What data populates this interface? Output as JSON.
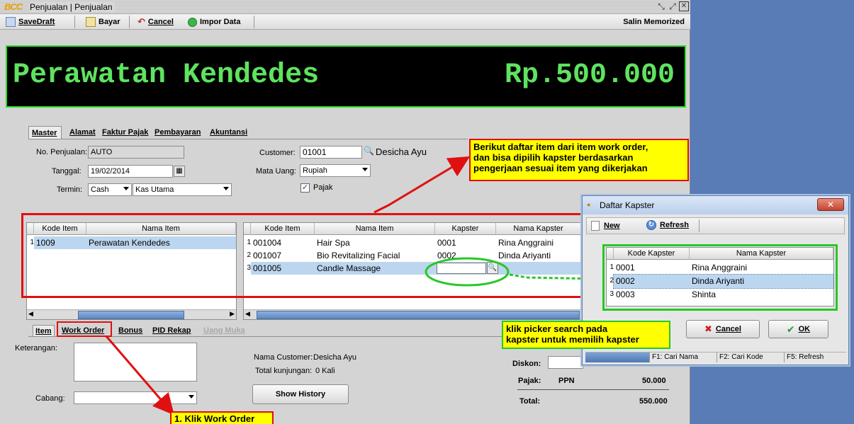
{
  "window": {
    "logo": "BCC",
    "title": "Penjualan | Penjualan",
    "controls": [
      "restore",
      "maximize",
      "close"
    ]
  },
  "toolbar": {
    "save_draft": "SaveDraft",
    "bayar": "Bayar",
    "cancel": "Cancel",
    "impor_data": "Impor Data",
    "salin_memorized": "Salin Memorized"
  },
  "banner": {
    "title": "Perawatan Kendedes",
    "amount": "Rp.500.000",
    "text_color": "#5fe35f",
    "border_color": "#2ddc2d"
  },
  "tabs": {
    "master": "Master",
    "alamat": "Alamat",
    "faktur_pajak": "Faktur Pajak",
    "pembayaran": "Pembayaran",
    "akuntansi": "Akuntansi"
  },
  "form": {
    "no_penjualan_label": "No. Penjualan:",
    "no_penjualan_value": "AUTO",
    "tanggal_label": "Tanggal:",
    "tanggal_value": "19/02/2014",
    "termin_label": "Termin:",
    "termin_value": "Cash",
    "kas_value": "Kas Utama",
    "customer_label": "Customer:",
    "customer_code": "01001",
    "customer_name": "Desicha Ayu",
    "mata_uang_label": "Mata Uang:",
    "mata_uang_value": "Rupiah",
    "pajak_label": "Pajak",
    "pajak_checked": true
  },
  "left_grid": {
    "headers": [
      "Kode Item",
      "Nama Item"
    ],
    "rows": [
      {
        "no": "1",
        "kode": "1009",
        "nama": "Perawatan Kendedes"
      }
    ]
  },
  "right_grid": {
    "headers": [
      "Kode Item",
      "Nama Item",
      "Kapster",
      "Nama Kapster"
    ],
    "rows": [
      {
        "no": "1",
        "kode": "001004",
        "nama": "Hair Spa",
        "kapster": "0001",
        "nama_kapster": "Rina Anggraini"
      },
      {
        "no": "2",
        "kode": "001007",
        "nama": "Bio  Revitalizing Facial",
        "kapster": "0002",
        "nama_kapster": "Dinda Ariyanti"
      },
      {
        "no": "3",
        "kode": "001005",
        "nama": "Candle Massage",
        "kapster": "",
        "nama_kapster": ""
      }
    ]
  },
  "bottom_tabs": {
    "item": "Item",
    "work_order": "Work Order",
    "bonus": "Bonus",
    "pid_rekap": "PID Rekap",
    "uang_muka": "Uang Muka"
  },
  "bottom": {
    "keterangan_label": "Keterangan:",
    "cabang_label": "Cabang:",
    "nama_customer_label": "Nama Customer:",
    "nama_customer_value": "Desicha Ayu",
    "total_kunjungan_label": "Total kunjungan:",
    "total_kunjungan_value": "0 Kali",
    "show_history": "Show History",
    "diskon_label": "Diskon:",
    "pajak_label": "Pajak:",
    "pajak_type": "PPN",
    "pajak_value": "50.000",
    "total_label": "Total:",
    "total_value": "550.000"
  },
  "dialog": {
    "title": "Daftar Kapster",
    "new": "New",
    "refresh": "Refresh",
    "headers": [
      "Kode Kapster",
      "Nama Kapster"
    ],
    "rows": [
      {
        "no": "1",
        "kode": "0001",
        "nama": "Rina Anggraini"
      },
      {
        "no": "2",
        "kode": "0002",
        "nama": "Dinda Ariyanti"
      },
      {
        "no": "3",
        "kode": "0003",
        "nama": "Shinta"
      }
    ],
    "cancel": "Cancel",
    "ok": "OK",
    "status": [
      "F1: Cari Nama",
      "F2: Cari Kode",
      "F5: Refresh"
    ]
  },
  "annotations": {
    "note_items_line1": "Berikut daftar item dari item work order,",
    "note_items_line2": "dan bisa dipilih kapster berdasarkan",
    "note_items_line3": "pengerjaan sesuai item yang dikerjakan",
    "note_picker_line1": "klik picker search pada",
    "note_picker_line2": "kapster untuk memilih kapster",
    "note_work_order": "1. Klik Work Order",
    "red": "#e01010",
    "green": "#28c828",
    "yellow": "#ffff00"
  }
}
